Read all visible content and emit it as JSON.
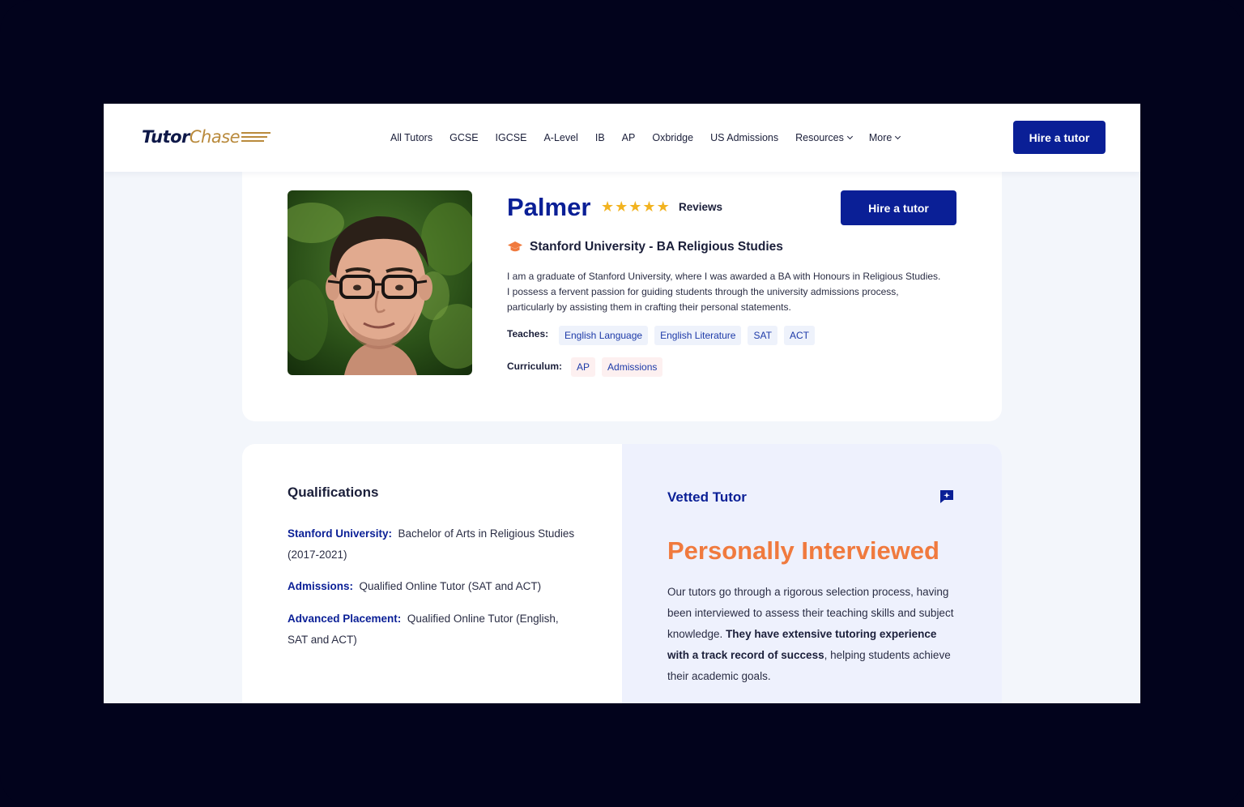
{
  "header": {
    "logo_part1": "Tutor",
    "logo_part2": "Chase",
    "nav": [
      {
        "label": "All Tutors",
        "dropdown": false
      },
      {
        "label": "GCSE",
        "dropdown": false
      },
      {
        "label": "IGCSE",
        "dropdown": false
      },
      {
        "label": "A-Level",
        "dropdown": false
      },
      {
        "label": "IB",
        "dropdown": false
      },
      {
        "label": "AP",
        "dropdown": false
      },
      {
        "label": "Oxbridge",
        "dropdown": false
      },
      {
        "label": "US Admissions",
        "dropdown": false
      },
      {
        "label": "Resources",
        "dropdown": true
      },
      {
        "label": "More",
        "dropdown": true
      }
    ],
    "cta": "Hire a tutor"
  },
  "profile": {
    "name": "Palmer",
    "rating": 5,
    "reviews_label": "Reviews",
    "cta": "Hire a tutor",
    "university": "Stanford University - BA Religious Studies",
    "bio": "I am a graduate of Stanford University, where I was awarded a BA with Honours in Religious Studies. I possess a fervent passion for guiding students through the university admissions process, particularly by assisting them in crafting their personal statements.",
    "teaches_label": "Teaches:",
    "teaches": [
      "English Language",
      "English Literature",
      "SAT",
      "ACT"
    ],
    "curriculum_label": "Curriculum:",
    "curriculum": [
      "AP",
      "Admissions"
    ]
  },
  "qualifications": {
    "title": "Qualifications",
    "items": [
      {
        "key": "Stanford University:",
        "value": "Bachelor of Arts in Religious Studies (2017-2021)"
      },
      {
        "key": "Admissions:",
        "value": "Qualified Online Tutor (SAT and ACT)"
      },
      {
        "key": "Advanced Placement:",
        "value": "Qualified Online Tutor (English, SAT and ACT)"
      }
    ]
  },
  "vetted": {
    "title": "Vetted Tutor",
    "headline": "Personally Interviewed",
    "text_1": "Our tutors go through a rigorous selection process, having been interviewed to assess their teaching skills and subject knowledge. ",
    "text_bold": "They have extensive tutoring experience with a track record of success",
    "text_2": ", helping students achieve their academic goals."
  },
  "colors": {
    "brand_blue": "#0a1f96",
    "accent_orange": "#f07a3e",
    "star_gold": "#f2b320",
    "logo_gold": "#b98a3c"
  }
}
